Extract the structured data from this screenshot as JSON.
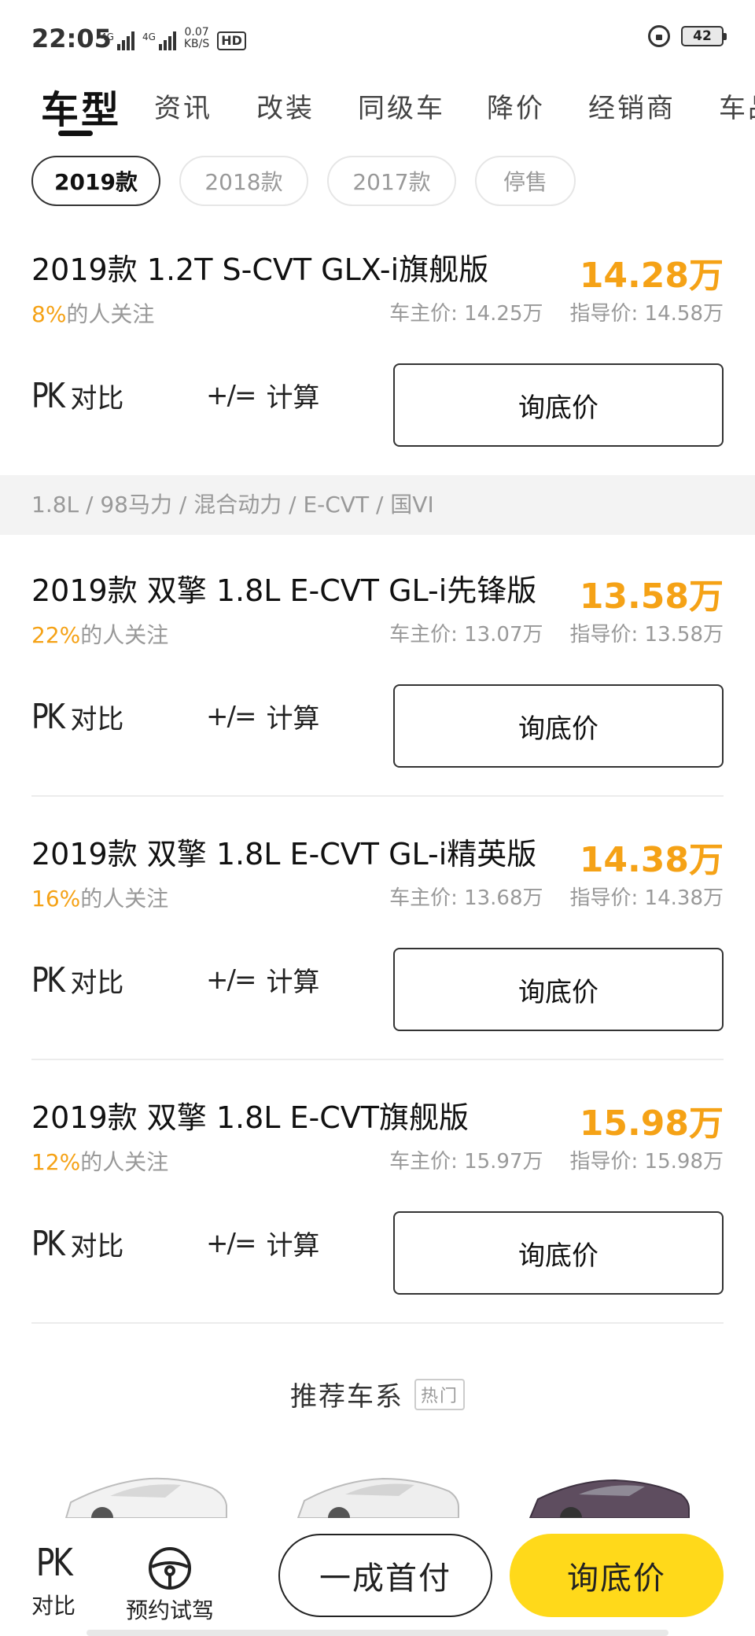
{
  "status": {
    "time": "22:05",
    "net1": "4G",
    "net2": "4G",
    "speed_value": "0.07",
    "speed_unit": "KB/S",
    "hd": "HD",
    "battery": "42"
  },
  "tabs": [
    "车型",
    "资讯",
    "改装",
    "同级车",
    "降价",
    "经销商",
    "车品"
  ],
  "years": [
    "2019款",
    "2018款",
    "2017款",
    "停售"
  ],
  "cars": [
    {
      "name": "2019款 1.2T S-CVT GLX-i旗舰版",
      "price": "14.28万",
      "attention_pct": "8%",
      "attention_text": "的人关注",
      "owner_price": "车主价: 14.25万",
      "guide_price": "指导价: 14.58万"
    },
    {
      "name": "2019款 双擎 1.8L E-CVT GL-i先锋版",
      "price": "13.58万",
      "attention_pct": "22%",
      "attention_text": "的人关注",
      "owner_price": "车主价: 13.07万",
      "guide_price": "指导价: 13.58万"
    },
    {
      "name": "2019款 双擎 1.8L E-CVT GL-i精英版",
      "price": "14.38万",
      "attention_pct": "16%",
      "attention_text": "的人关注",
      "owner_price": "车主价: 13.68万",
      "guide_price": "指导价: 14.38万"
    },
    {
      "name": "2019款 双擎 1.8L E-CVT旗舰版",
      "price": "15.98万",
      "attention_pct": "12%",
      "attention_text": "的人关注",
      "owner_price": "车主价: 15.97万",
      "guide_price": "指导价: 15.98万"
    }
  ],
  "actions": {
    "pk_icon": "PK",
    "pk_label": "对比",
    "calc_icon": "+/=",
    "calc_label": "计算",
    "ask_label": "询底价"
  },
  "group_header": "1.8L / 98马力 / 混合动力 / E-CVT / 国VI",
  "recommend": {
    "title": "推荐车系",
    "tag": "热门"
  },
  "bottom": {
    "pk_icon": "PK",
    "pk_label": "对比",
    "drive_label": "预约试驾",
    "downpay_label": "一成首付",
    "ask_label": "询底价"
  },
  "colors": {
    "accent": "#f5a216",
    "cta": "#ffd91a"
  }
}
